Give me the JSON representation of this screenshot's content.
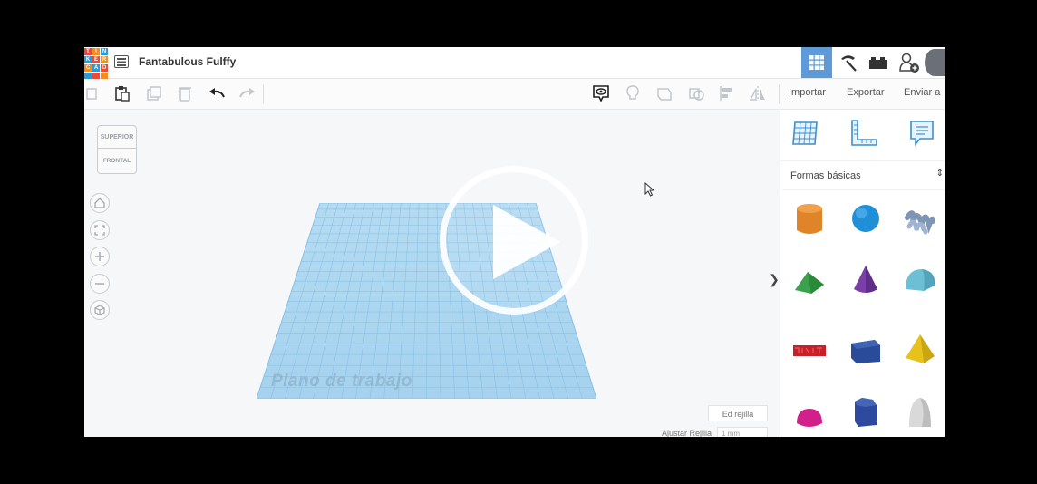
{
  "app": {
    "title": "Fantabulous Fulffy",
    "logo_letters": [
      "T",
      "I",
      "N",
      "K",
      "E",
      "R",
      "C",
      "A",
      "D"
    ]
  },
  "toolbar": {
    "menu": {
      "import": "Importar",
      "export": "Exportar",
      "send": "Enviar a"
    }
  },
  "viewcube": {
    "top": "SUPERIOR",
    "front": "FRONTAL"
  },
  "workplane": {
    "label": "Plano de trabajo"
  },
  "grid": {
    "edit_label": "Ed rejilla",
    "snap_label": "Ajustar Rejilla",
    "snap_value": "1 mm"
  },
  "shapes_panel": {
    "category": "Formas básicas",
    "shapes": [
      "box-cylinder",
      "sphere",
      "scribble",
      "roof",
      "cone",
      "round-roof",
      "text",
      "box",
      "pyramid",
      "half-sphere",
      "polygon",
      "paraboloid"
    ]
  },
  "colors": {
    "accent": "#5e9ad9",
    "workplane": "#8fc6e8",
    "cylinder": "#e0842a",
    "sphere": "#1f8fd8",
    "roof": "#3aa14c",
    "cone": "#7a3fa6",
    "round_roof": "#6cbfd4",
    "text": "#c8202a",
    "box": "#2a4a9a",
    "pyramid": "#e6c21a",
    "half_sphere": "#d0208a",
    "polygon": "#2e4a9e",
    "paraboloid": "#d9d9d9"
  }
}
